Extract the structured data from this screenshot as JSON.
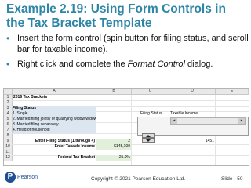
{
  "slide": {
    "title": "Example 2.19:  Using Form Controls in the Tax Bracket Template",
    "bullets": [
      {
        "text": "Insert the form control (spin button for filing status, and scroll bar for taxable income)."
      },
      {
        "text_before": "Right click and complete the ",
        "text_italic": "Format Control",
        "text_after": " dialog."
      }
    ],
    "copyright": "Copyright © 2021 Pearson Education Ltd.",
    "slide_number": "Slide - 50",
    "logo_text": "Pearson",
    "logo_mark": "P"
  },
  "sheet": {
    "columns": [
      "A",
      "B",
      "C",
      "D",
      "E"
    ],
    "rows": [
      "1",
      "2",
      "3",
      "4",
      "5",
      "6",
      "7",
      "8",
      "9",
      "10",
      "11",
      "12"
    ],
    "cells": {
      "a1": "2016 Tax Brackets",
      "a3": "Filing Status",
      "a4": "1. Single",
      "a5": "2. Married filing jointly or qualifying widow/widower",
      "a6": "3. Married filing separately",
      "a7": "4. Head of household",
      "c4": "Filing Status",
      "d4": "Taxable Income",
      "label9": "Enter Filing Status (1 through 4)",
      "b9": "2",
      "d9": "1451",
      "label10": "Enter Taxable Income",
      "b10": "$145,100",
      "label12": "Federal Tax Bracket",
      "b12": "25.0%"
    },
    "scroll_left_glyph": "◂",
    "scroll_right_glyph": "▸"
  },
  "icons": {
    "spin_up": "triangle-up-icon",
    "spin_down": "triangle-down-icon"
  }
}
